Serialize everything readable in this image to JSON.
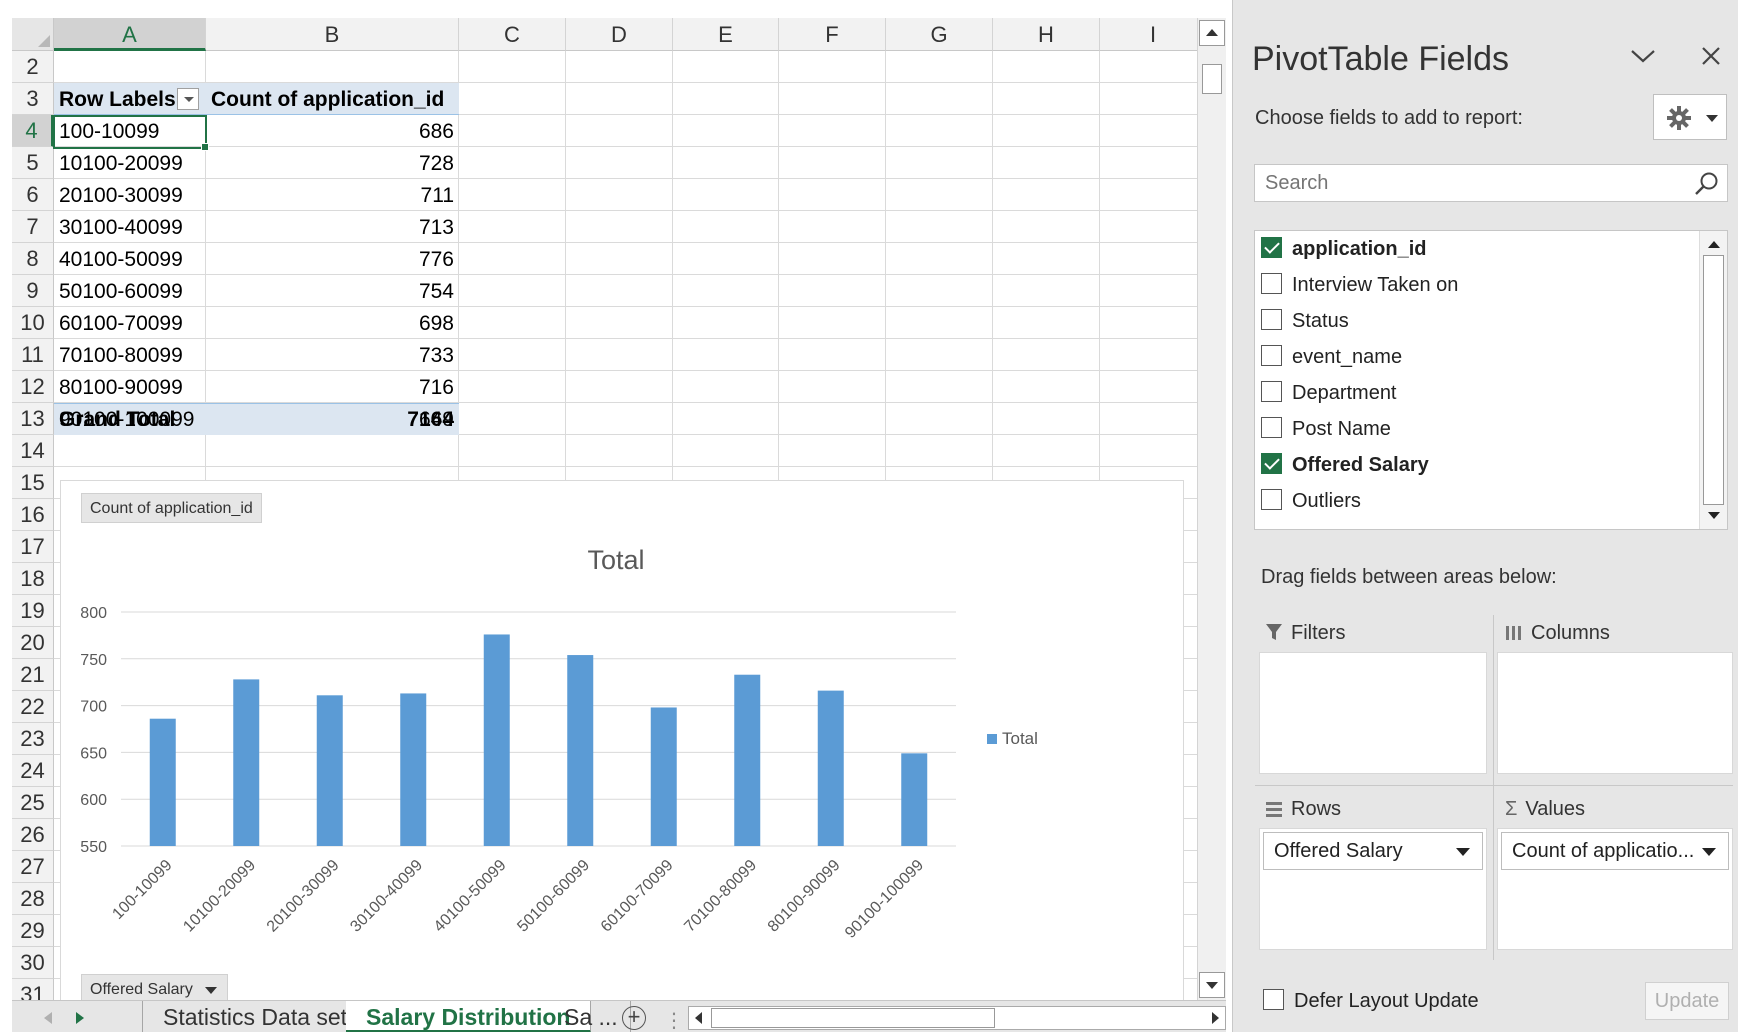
{
  "columns": [
    "A",
    "B",
    "C",
    "D",
    "E",
    "F",
    "G",
    "H",
    "I"
  ],
  "rows": [
    "2",
    "3",
    "4",
    "5",
    "6",
    "7",
    "8",
    "9",
    "10",
    "11",
    "12",
    "13",
    "14",
    "15",
    "16",
    "17",
    "18",
    "19",
    "20",
    "21",
    "22",
    "23",
    "24",
    "25",
    "26",
    "27",
    "28",
    "29",
    "30",
    "31"
  ],
  "pivot": {
    "header_row_labels": "Row Labels",
    "header_count": "Count of application_id",
    "items": [
      {
        "label": "100-10099",
        "value": "686"
      },
      {
        "label": "10100-20099",
        "value": "728"
      },
      {
        "label": "20100-30099",
        "value": "711"
      },
      {
        "label": "30100-40099",
        "value": "713"
      },
      {
        "label": "40100-50099",
        "value": "776"
      },
      {
        "label": "50100-60099",
        "value": "754"
      },
      {
        "label": "60100-70099",
        "value": "698"
      },
      {
        "label": "70100-80099",
        "value": "733"
      },
      {
        "label": "80100-90099",
        "value": "716"
      },
      {
        "label": "90100-100099",
        "value": "649"
      }
    ],
    "grand_total_label": "Grand Total",
    "grand_total_value": "7164"
  },
  "chart_field_buttons": {
    "values_button": "Count of application_id",
    "axis_button": "Offered Salary"
  },
  "chart_data": {
    "type": "bar",
    "title": "Total",
    "categories": [
      "100-10099",
      "10100-20099",
      "20100-30099",
      "30100-40099",
      "40100-50099",
      "50100-60099",
      "60100-70099",
      "70100-80099",
      "80100-90099",
      "90100-100099"
    ],
    "series": [
      {
        "name": "Total",
        "values": [
          686,
          728,
          711,
          713,
          776,
          754,
          698,
          733,
          716,
          649
        ],
        "color": "#5b9bd5"
      }
    ],
    "ylim": [
      550,
      800
    ],
    "yticks": [
      550,
      600,
      650,
      700,
      750,
      800
    ],
    "grid": true,
    "legend": "right",
    "xlabel": "",
    "ylabel": ""
  },
  "sheet_tabs": [
    "Statistics Data set",
    "Salary Distribution",
    "Sa ..."
  ],
  "active_tab": "Salary Distribution",
  "pane": {
    "title": "PivotTable Fields",
    "choose_label": "Choose fields to add to report:",
    "search_placeholder": "Search",
    "fields": [
      {
        "name": "application_id",
        "checked": true
      },
      {
        "name": "Interview Taken on",
        "checked": false
      },
      {
        "name": "Status",
        "checked": false
      },
      {
        "name": "event_name",
        "checked": false
      },
      {
        "name": "Department",
        "checked": false
      },
      {
        "name": "Post Name",
        "checked": false
      },
      {
        "name": "Offered Salary",
        "checked": true
      },
      {
        "name": "Outliers",
        "checked": false
      }
    ],
    "drag_label": "Drag fields between areas below:",
    "areas": {
      "filters": "Filters",
      "columns": "Columns",
      "rows": "Rows",
      "values": "Values",
      "rows_item": "Offered Salary",
      "values_item": "Count of applicatio..."
    },
    "defer_label": "Defer Layout Update",
    "update_label": "Update"
  },
  "colors": {
    "accent": "#217346",
    "bar": "#5b9bd5",
    "pivot_band": "#dce6f1"
  }
}
